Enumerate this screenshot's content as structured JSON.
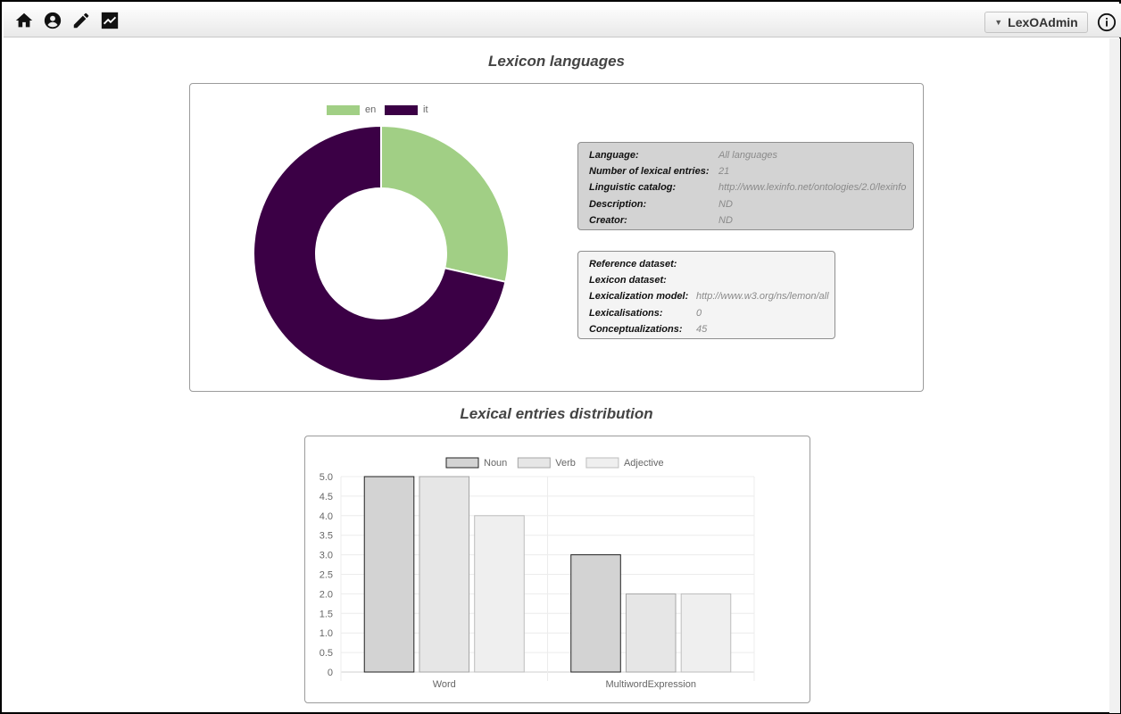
{
  "toolbar": {
    "user_menu_label": "LexOAdmin"
  },
  "icons": {
    "home": "home-icon",
    "account": "account-circle-icon",
    "edit": "pencil-icon",
    "stats": "chart-line-icon",
    "info": "info-icon",
    "caret": "caret-down-icon"
  },
  "languages_section": {
    "title": "Lexicon languages",
    "legend": [
      {
        "label": "en",
        "color": "#a1cf85"
      },
      {
        "label": "it",
        "color": "#3b0045"
      }
    ],
    "language_info": {
      "rows": [
        {
          "key": "Language:",
          "value": "All languages"
        },
        {
          "key": "Number of lexical entries:",
          "value": "21"
        },
        {
          "key": "Linguistic catalog:",
          "value": "http://www.lexinfo.net/ontologies/2.0/lexinfo"
        },
        {
          "key": "Description:",
          "value": "ND"
        },
        {
          "key": "Creator:",
          "value": "ND"
        }
      ]
    },
    "dataset_info": {
      "rows": [
        {
          "key": "Reference dataset:",
          "value": ""
        },
        {
          "key": "Lexicon dataset:",
          "value": ""
        },
        {
          "key": "Lexicalization model:",
          "value": "http://www.w3.org/ns/lemon/all"
        },
        {
          "key": "Lexicalisations:",
          "value": "0"
        },
        {
          "key": "Conceptualizations:",
          "value": "45"
        }
      ]
    }
  },
  "distribution_section": {
    "title": "Lexical entries distribution"
  },
  "chart_data": [
    {
      "type": "pie",
      "variant": "doughnut",
      "labels": [
        "en",
        "it"
      ],
      "values": [
        6,
        15
      ],
      "colors": [
        "#a1cf85",
        "#3b0045"
      ],
      "legend": "top"
    },
    {
      "type": "bar",
      "categories": [
        "Word",
        "MultiwordExpression"
      ],
      "series": [
        {
          "name": "Noun",
          "values": [
            5,
            3
          ],
          "color": "#d3d3d3",
          "border": "#222222"
        },
        {
          "name": "Verb",
          "values": [
            5,
            2
          ],
          "color": "#e6e6e6",
          "border": "#a5a5a5"
        },
        {
          "name": "Adjective",
          "values": [
            4,
            2
          ],
          "color": "#efefef",
          "border": "#bdbdbd"
        }
      ],
      "ylim": [
        0,
        5
      ],
      "yticks": [
        "5.0",
        "4.5",
        "4.0",
        "3.5",
        "3.0",
        "2.5",
        "2.0",
        "1.5",
        "1.0",
        "0.5",
        "0"
      ],
      "grid": true,
      "legend": "top"
    }
  ]
}
